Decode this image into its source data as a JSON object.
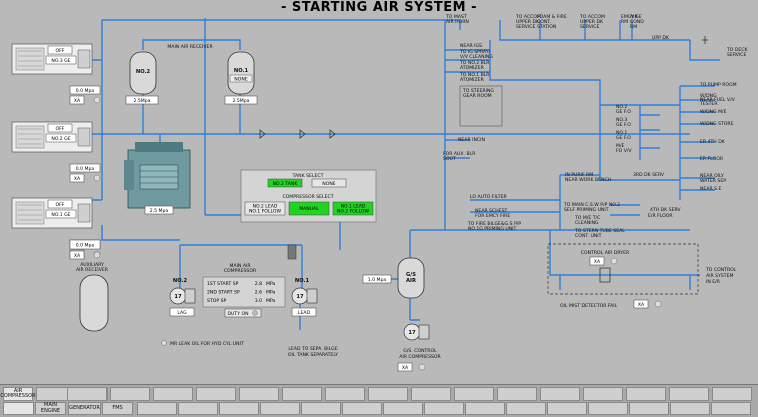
{
  "title": "- STARTING AIR SYSTEM -",
  "colors": {
    "pipe": "#2f7fd9",
    "active_green": "#22d422",
    "background": "#b9b9b9"
  },
  "top_destinations": [
    {
      "id": "mast",
      "lines": [
        "TO MAST",
        "AIR HORN"
      ]
    },
    {
      "id": "accom",
      "lines": [
        "TO ACCOM",
        "UPPER DK",
        "SERVICE"
      ]
    },
    {
      "id": "foam",
      "lines": [
        "FOAM & FIRE",
        "CONT.",
        "STATION"
      ]
    },
    {
      "id": "accom2",
      "lines": [
        "TO ACCOM",
        "UPPER DK",
        "SERVICE"
      ]
    },
    {
      "id": "emcy",
      "lines": [
        "EMCY GE",
        "RM"
      ]
    },
    {
      "id": "aircond",
      "lines": [
        "AIR",
        "COND",
        "RM"
      ]
    }
  ],
  "upp_dk": "UPP DK",
  "deck_service": [
    "TO DECK",
    "SERVICE"
  ],
  "gensets": [
    {
      "id": "ge3",
      "status": "OFF",
      "name": "NO.3 GE",
      "pressure": "0.0 Mpa",
      "mode": "XA"
    },
    {
      "id": "ge2",
      "status": "OFF",
      "name": "NO.2 GE",
      "pressure": "0.0 Mpa",
      "mode": "XA"
    },
    {
      "id": "ge1",
      "status": "OFF",
      "name": "NO.1 GE",
      "pressure": "0.0 Mpa",
      "mode": "XA"
    }
  ],
  "main_air_receiver": {
    "label": "MAIN AIR RECEIVER",
    "receivers": [
      {
        "id": "no2",
        "name": "NO.2",
        "pressure": "2.5Mpa"
      },
      {
        "id": "no1",
        "name": "NO.1",
        "sub": "NONE",
        "pressure": "2.5Mpa"
      }
    ]
  },
  "main_engine_pressure": "2.5 Mpa",
  "aux_receiver": {
    "pressure": "0.0 Mpa",
    "mode": "XA",
    "label": [
      "AUXILIARY",
      "AIR RECEIVER"
    ]
  },
  "tank_select": {
    "label": "TANK SELECT",
    "options": [
      "NO.2 TANK",
      "NONE"
    ],
    "active": 0
  },
  "compressor_select": {
    "label": "COMPRESSOR SELECT",
    "options": [
      "NO.2 LEAD NO.1 FOLLOW",
      "MANUAL",
      "NO.1 LEAD NO.2 FOLLOW"
    ],
    "active": [
      1,
      2
    ]
  },
  "main_compressor": {
    "label": [
      "MAIN AIR",
      "COMPRESSOR"
    ],
    "settings": [
      {
        "label": "1ST START SP",
        "value": "2.8",
        "unit": "MPa"
      },
      {
        "label": "2ND START SP",
        "value": "2.6",
        "unit": "MPa"
      },
      {
        "label": "STOP SP",
        "value": "3.0",
        "unit": "MPa"
      }
    ],
    "duty": "DUTY ON",
    "units": [
      {
        "id": "no2",
        "name": "NO.2",
        "role": "LAG",
        "num": "17"
      },
      {
        "id": "no1",
        "name": "NO.1",
        "role": "LEAD",
        "num": "17"
      }
    ]
  },
  "mid_labels": {
    "leak_oil": "MR LEAK OIL FOR HYD CYL UNIT",
    "sepa": [
      "LEAD TO SEPA. BILGE",
      "OIL TANK SEPARATELY"
    ],
    "gs_air": [
      "G/S",
      "AIR"
    ],
    "gs_pressure": "1.0 Mpa",
    "gs_control": [
      "G/S. CONTROL",
      "AIR COMPRESSOR"
    ],
    "gs_mode": "XA",
    "gs_num": "17"
  },
  "consumers_left": [
    "NEAR IGS",
    "TO IG SPRAY/",
    "V/V CLEANING",
    "TO NO.2 BLR",
    "ATOMIZER",
    "TO NO.1 BLR",
    "ATOMIZER",
    "TO STEERING",
    "GEAR ROOM",
    "NEAR INCIN",
    "FOR AUX. BLR",
    "SOOT"
  ],
  "consumers_right": [
    "TO PUMP ROOM",
    "W/DNG",
    "NEAR FUEL V/V",
    "TESTER",
    "W/DNG M/E",
    "W/DNG STORE",
    "NO.2",
    "GE F.O",
    "NO.3",
    "GE F.O",
    "NO.1",
    "GE F.O",
    "M/E",
    "FO V/V",
    "ER 4TH DK",
    "ER FLOOR",
    "NEAR OILY",
    "WATER SEP",
    "NEAR S.E"
  ],
  "lower_labels": [
    "IN PURIF RM",
    "NEAR WORK BENCH",
    "3RD DK SERV",
    "LO AUTO FILTER",
    "TO MAIN C.S.W P/P NO.2",
    "SELF PRIMING UNIT",
    "NEAR SCHEST",
    "FOR EMCY FIRE",
    "TO M/E T/C",
    "CLEANING",
    "TO FIRE BILGE&G.S P/P",
    "NO.1G PRIMING UNIT",
    "TO STERN TUBE SEAL",
    "CONT. UNIT",
    "4TH DK SERV",
    "E/R FLOOR"
  ],
  "control_air": {
    "label": "CONTROL AIR DRYER",
    "mode": "XA"
  },
  "control_air_dest": [
    "TO CONTROL",
    "AIR SYSTEM",
    "IN E/R"
  ],
  "oil_mist": {
    "label": "OIL MIST DETECTOR FAIL",
    "mode": "XA"
  },
  "nav_tabs": [
    {
      "id": "aircomp",
      "lines": [
        "AIR",
        "COMPRESSOR"
      ],
      "active": true
    },
    {
      "id": "mainengine",
      "lines": [
        "MAIN",
        "ENGINE"
      ],
      "active": false
    },
    {
      "id": "generator",
      "lines": [
        "GENERATOR"
      ],
      "active": false
    },
    {
      "id": "fms",
      "lines": [
        "FMS"
      ],
      "active": false
    }
  ]
}
